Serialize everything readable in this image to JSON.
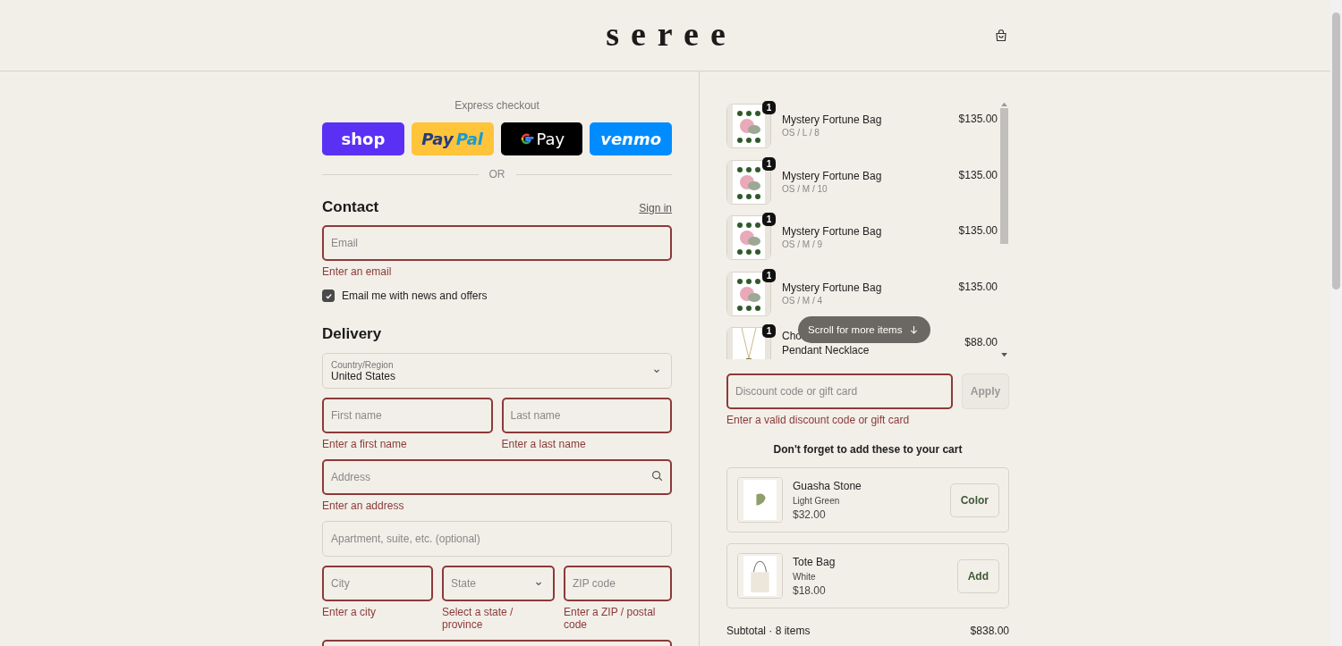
{
  "header": {
    "logo": "seree"
  },
  "express": {
    "title": "Express checkout",
    "divider": "OR",
    "buttons": [
      {
        "kind": "shop",
        "label_parts": [
          "shop"
        ]
      },
      {
        "kind": "paypal",
        "label_parts": [
          "Pay",
          "Pal"
        ]
      },
      {
        "kind": "gpay",
        "label_parts": [
          "Pay"
        ]
      },
      {
        "kind": "venmo",
        "label_parts": [
          "venmo"
        ]
      }
    ]
  },
  "contact": {
    "title": "Contact",
    "sign_in": "Sign in",
    "email": {
      "placeholder": "Email",
      "error": "Enter an email",
      "invalid": true
    },
    "newsletter": {
      "label": "Email me with news and offers",
      "checked": true
    }
  },
  "delivery": {
    "title": "Delivery",
    "country": {
      "label": "Country/Region",
      "value": "United States"
    },
    "rows": [
      [
        {
          "kind": "text",
          "placeholder": "First name",
          "error": "Enter a first name",
          "invalid": true
        },
        {
          "kind": "text",
          "placeholder": "Last name",
          "error": "Enter a last name",
          "invalid": true
        }
      ],
      [
        {
          "kind": "search",
          "placeholder": "Address",
          "error": "Enter an address",
          "invalid": true
        }
      ],
      [
        {
          "kind": "text",
          "placeholder": "Apartment, suite, etc. (optional)",
          "invalid": false
        }
      ],
      [
        {
          "kind": "text",
          "placeholder": "City",
          "error": "Enter a city",
          "invalid": true
        },
        {
          "kind": "select",
          "placeholder": "State",
          "error": "Select a state / province",
          "invalid": true
        },
        {
          "kind": "text",
          "placeholder": "ZIP code",
          "error": "Enter a ZIP / postal code",
          "invalid": true
        }
      ],
      [
        {
          "kind": "text",
          "invalid": true
        }
      ]
    ]
  },
  "cart": {
    "scroll_hint": "Scroll for more items",
    "items": [
      {
        "name_lines": [
          "Mystery Fortune Bag"
        ],
        "variant": "OS / L / 8",
        "price": "$135.00",
        "quantity": "1"
      },
      {
        "name_lines": [
          "Mystery Fortune Bag"
        ],
        "variant": "OS / M / 10",
        "price": "$135.00",
        "quantity": "1"
      },
      {
        "name_lines": [
          "Mystery Fortune Bag"
        ],
        "variant": "OS / M / 9",
        "price": "$135.00",
        "quantity": "1"
      },
      {
        "name_lines": [
          "Mystery Fortune Bag"
        ],
        "variant": "OS / M / 4",
        "price": "$135.00",
        "quantity": "1"
      },
      {
        "name_lines": [
          "Cho",
          "Pendant Necklace"
        ],
        "price": "$88.00",
        "quantity": "1"
      }
    ]
  },
  "discount": {
    "placeholder": "Discount code or gift card",
    "error": "Enter a valid discount code or gift card",
    "invalid": true,
    "apply": "Apply",
    "apply_disabled": true
  },
  "upsell": {
    "title": "Don't forget to add these to your cart",
    "items": [
      {
        "name": "Guasha Stone",
        "variant": "Light Green",
        "price": "$32.00",
        "action": "Color"
      },
      {
        "name": "Tote Bag",
        "variant": "White",
        "price": "$18.00",
        "action": "Add"
      }
    ]
  },
  "summary": [
    {
      "label": "Subtotal · 8 items",
      "value": "$838.00"
    }
  ]
}
